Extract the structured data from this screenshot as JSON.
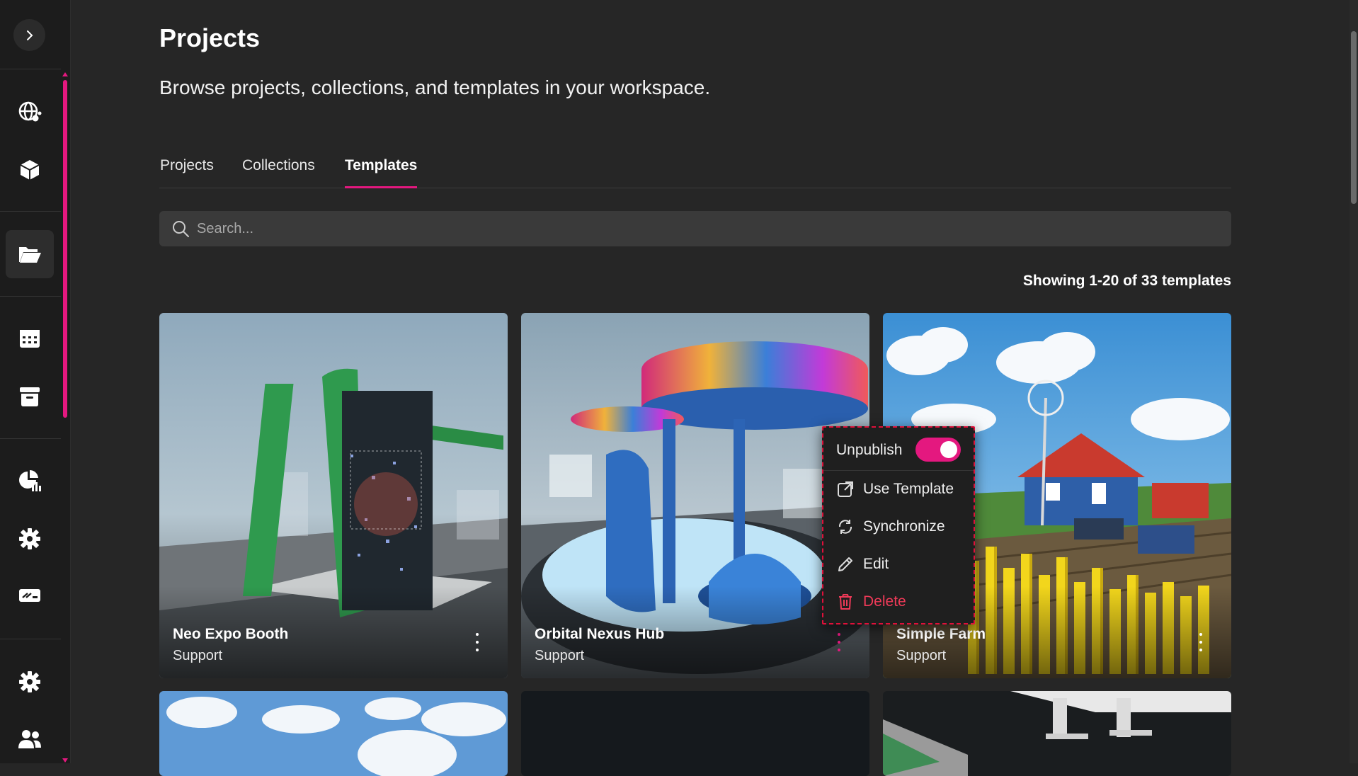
{
  "header": {
    "title": "Projects",
    "subtitle": "Browse projects, collections, and templates in your workspace."
  },
  "tabs": [
    {
      "label": "Projects",
      "active": false
    },
    {
      "label": "Collections",
      "active": false
    },
    {
      "label": "Templates",
      "active": true
    }
  ],
  "search": {
    "placeholder": "Search..."
  },
  "results": {
    "summary": "Showing 1-20 of 33 templates"
  },
  "sidebar": {
    "items": [
      {
        "icon": "globe-network-icon"
      },
      {
        "icon": "cube-icon"
      },
      {
        "icon": "folder-open-icon",
        "active": true
      },
      {
        "icon": "calendar-icon"
      },
      {
        "icon": "archive-box-icon"
      },
      {
        "icon": "analytics-pie-icon"
      },
      {
        "icon": "gear-icon"
      },
      {
        "icon": "ticket-icon"
      },
      {
        "icon": "gear-icon"
      },
      {
        "icon": "people-icon"
      }
    ]
  },
  "cards": [
    {
      "title": "Neo Expo Booth",
      "subtitle": "Support"
    },
    {
      "title": "Orbital Nexus Hub",
      "subtitle": "Support"
    },
    {
      "title": "Simple Farm",
      "subtitle": "Support"
    }
  ],
  "context_menu": {
    "toggle_label": "Unpublish",
    "toggle_on": true,
    "items": [
      "Use Template",
      "Synchronize",
      "Edit",
      "Delete"
    ]
  },
  "colors": {
    "accent": "#e4187f",
    "danger": "#ef3a58",
    "background": "#262626",
    "sidebar": "#1c1c1c"
  }
}
